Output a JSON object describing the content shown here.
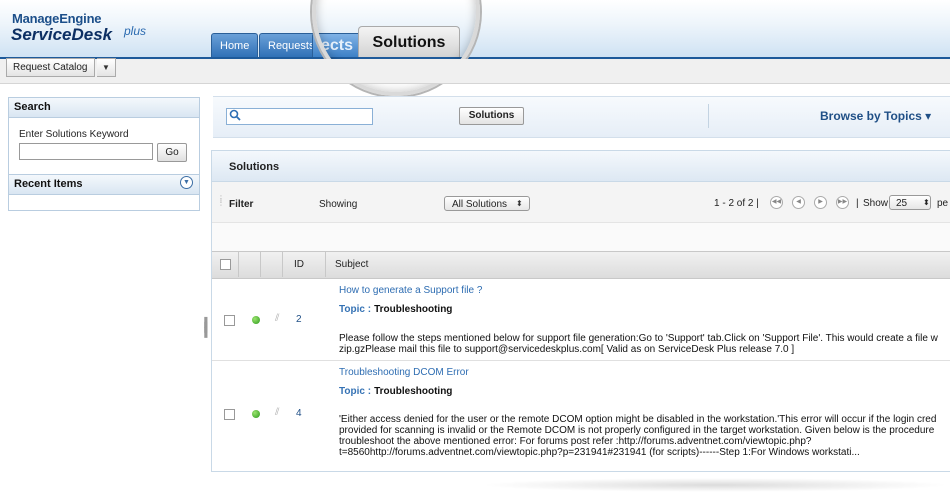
{
  "brand": {
    "top": "ManageEngine",
    "main": "ServiceDesk",
    "plus": "plus"
  },
  "tabs": [
    {
      "label": "Home"
    },
    {
      "label": "Requests"
    },
    {
      "label": "ects"
    },
    {
      "label": "Solutions",
      "active": true
    }
  ],
  "catalog": {
    "label": "Request Catalog"
  },
  "left_panel": {
    "search_title": "Search",
    "keyword_label": "Enter Solutions Keyword",
    "go_label": "Go",
    "recent_title": "Recent Items"
  },
  "search_bar": {
    "button_label": "Solutions",
    "browse_label": "Browse by Topics ▾"
  },
  "solutions": {
    "title": "Solutions",
    "filter_label": "Filter",
    "showing_label": "Showing",
    "filter_value": "All Solutions",
    "pager_text": "1 - 2 of 2 |",
    "pager_sep": "|",
    "show_label": "Show",
    "per_page": "25",
    "per_label": "pe",
    "columns": {
      "id": "ID",
      "subject": "Subject"
    },
    "rows": [
      {
        "id": "2",
        "title": "How to generate a Support file ?",
        "topic_key": "Topic :",
        "topic": "Troubleshooting",
        "desc_line1": "Please follow the steps mentioned below for support file generation:Go to 'Support' tab.Click on 'Support File'. This would create a file w",
        "desc_line2": "zip.gzPlease mail this file to support@servicedeskplus.com[ Valid as on ServiceDesk Plus release 7.0 ]"
      },
      {
        "id": "4",
        "title": "Troubleshooting DCOM Error",
        "topic_key": "Topic :",
        "topic": "Troubleshooting",
        "desc_line1": "'Either access denied for the user or the remote DCOM option might be disabled in the workstation.'This error will occur if the login cred",
        "desc_line2": "provided for scanning is invalid or the Remote DCOM is not properly configured in the target workstation. Given below is the procedure",
        "desc_line3": "troubleshoot the above mentioned error: For forums post refer :http://forums.adventnet.com/viewtopic.php?",
        "desc_line4": "t=8560http://forums.adventnet.com/viewtopic.php?p=231941#231941 (for scripts)------Step 1:For Windows workstati..."
      }
    ]
  },
  "colors": {
    "accent": "#2e6fb5",
    "link": "#2e6db2",
    "status_green": "#2c9a1c"
  },
  "icons": [
    "search-icon",
    "chevron-down-icon",
    "collapse-icon",
    "first-page-icon",
    "prev-page-icon",
    "next-page-icon",
    "last-page-icon",
    "status-dot-icon",
    "attachment-icon"
  ]
}
